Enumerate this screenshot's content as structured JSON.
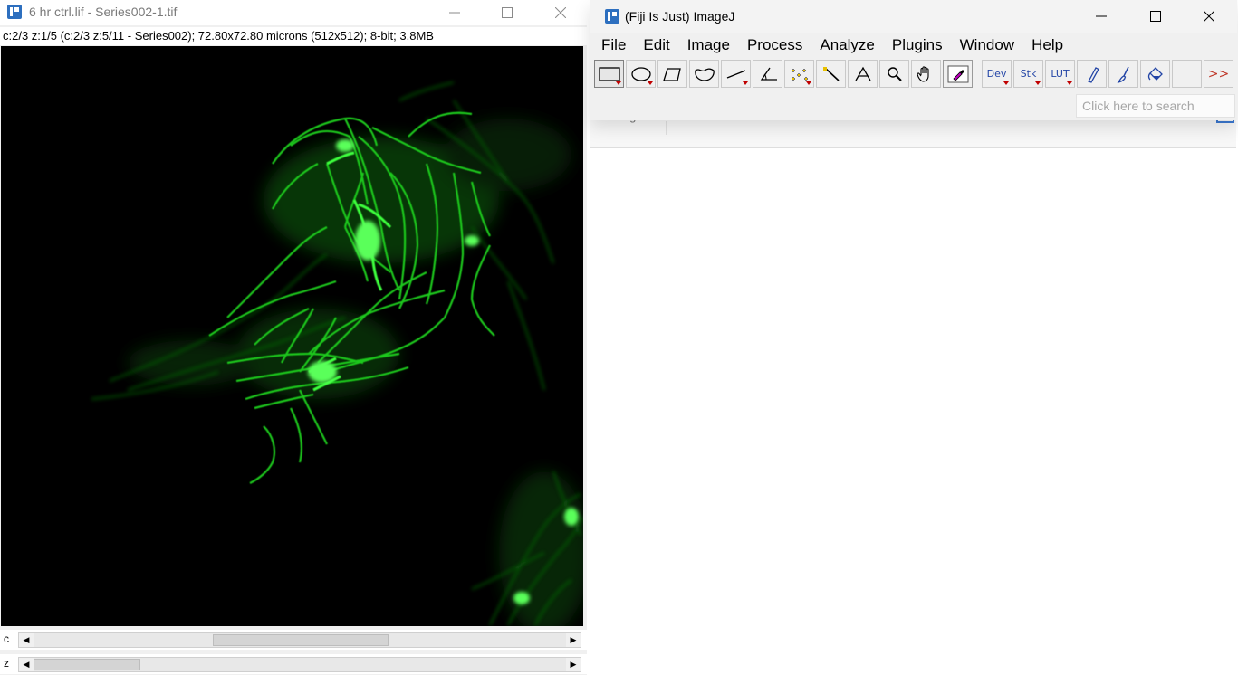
{
  "image_window": {
    "title": "6 hr ctrl.lif - Series002-1.tif",
    "info": "c:2/3 z:1/5 (c:2/3 z:5/11 - Series002); 72.80x72.80 microns (512x512); 8-bit; 3.8MB",
    "channel_label": "c",
    "slice_label": "z",
    "channel_position": {
      "value": 2,
      "count": 3
    },
    "slice_position": {
      "value": 1,
      "count": 5
    },
    "image_color": "#00ff00",
    "image_background": "#000000"
  },
  "fiji_window": {
    "title": "(Fiji Is Just) ImageJ",
    "menu": [
      "File",
      "Edit",
      "Image",
      "Process",
      "Analyze",
      "Plugins",
      "Window",
      "Help"
    ],
    "tools": [
      {
        "name": "rectangle-tool",
        "icon": "rectangle-icon",
        "active": true,
        "menu": true
      },
      {
        "name": "oval-tool",
        "icon": "oval-icon",
        "active": false,
        "menu": true
      },
      {
        "name": "polygon-tool",
        "icon": "polygon-icon",
        "active": false,
        "menu": false
      },
      {
        "name": "freehand-tool",
        "icon": "freehand-icon",
        "active": false,
        "menu": false
      },
      {
        "name": "line-tool",
        "icon": "line-icon",
        "active": false,
        "menu": true
      },
      {
        "name": "angle-tool",
        "icon": "angle-icon",
        "active": false,
        "menu": false
      },
      {
        "name": "point-tool",
        "icon": "multipoint-icon",
        "active": false,
        "menu": true
      },
      {
        "name": "wand-tool",
        "icon": "wand-icon",
        "active": false,
        "menu": false
      },
      {
        "name": "text-tool",
        "icon": "text-icon",
        "active": false,
        "menu": false
      },
      {
        "name": "zoom-tool",
        "icon": "magnifier-icon",
        "active": false,
        "menu": false
      },
      {
        "name": "hand-tool",
        "icon": "hand-icon",
        "active": false,
        "menu": false
      },
      {
        "name": "color-picker-tool",
        "icon": "dropper-icon",
        "active": false,
        "menu": false
      }
    ],
    "extra_tools": {
      "dev_label": "Dev",
      "stk_label": "Stk",
      "lut_label": "LUT",
      "more_label": ">>"
    },
    "search_placeholder": "Click here to search",
    "behind_text": "rotate right"
  },
  "accent_color": "#2d6fbf"
}
